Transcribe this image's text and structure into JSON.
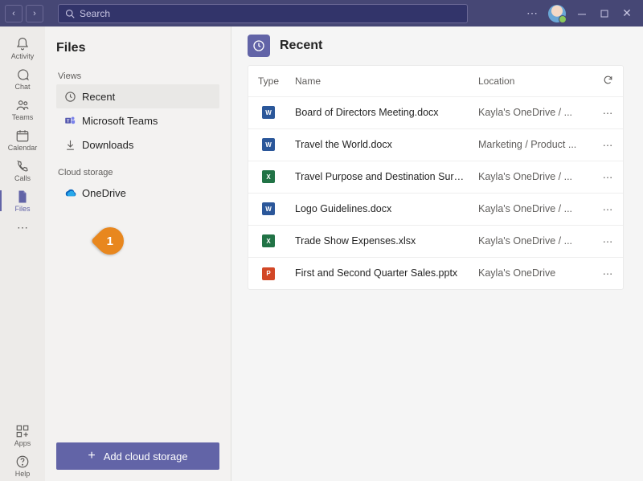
{
  "titlebar": {
    "search_placeholder": "Search"
  },
  "rail": {
    "activity": "Activity",
    "chat": "Chat",
    "teams": "Teams",
    "calendar": "Calendar",
    "calls": "Calls",
    "files": "Files",
    "apps": "Apps",
    "help": "Help"
  },
  "filesnav": {
    "title": "Files",
    "views_label": "Views",
    "recent": "Recent",
    "teams": "Microsoft Teams",
    "downloads": "Downloads",
    "cloud_label": "Cloud storage",
    "onedrive": "OneDrive",
    "add_cloud": "Add cloud storage"
  },
  "main": {
    "title": "Recent",
    "cols": {
      "type": "Type",
      "name": "Name",
      "location": "Location"
    },
    "rows": [
      {
        "type": "word",
        "name": "Board of Directors Meeting.docx",
        "location": "Kayla's OneDrive / ..."
      },
      {
        "type": "word",
        "name": "Travel the World.docx",
        "location": "Marketing / Product ..."
      },
      {
        "type": "excel",
        "name": "Travel Purpose and Destination Surve...",
        "location": "Kayla's OneDrive / ..."
      },
      {
        "type": "word",
        "name": "Logo Guidelines.docx",
        "location": "Kayla's OneDrive / ..."
      },
      {
        "type": "excel",
        "name": "Trade Show Expenses.xlsx",
        "location": "Kayla's OneDrive / ..."
      },
      {
        "type": "ppt",
        "name": "First and Second Quarter Sales.pptx",
        "location": "Kayla's OneDrive"
      }
    ]
  },
  "callout": "1"
}
